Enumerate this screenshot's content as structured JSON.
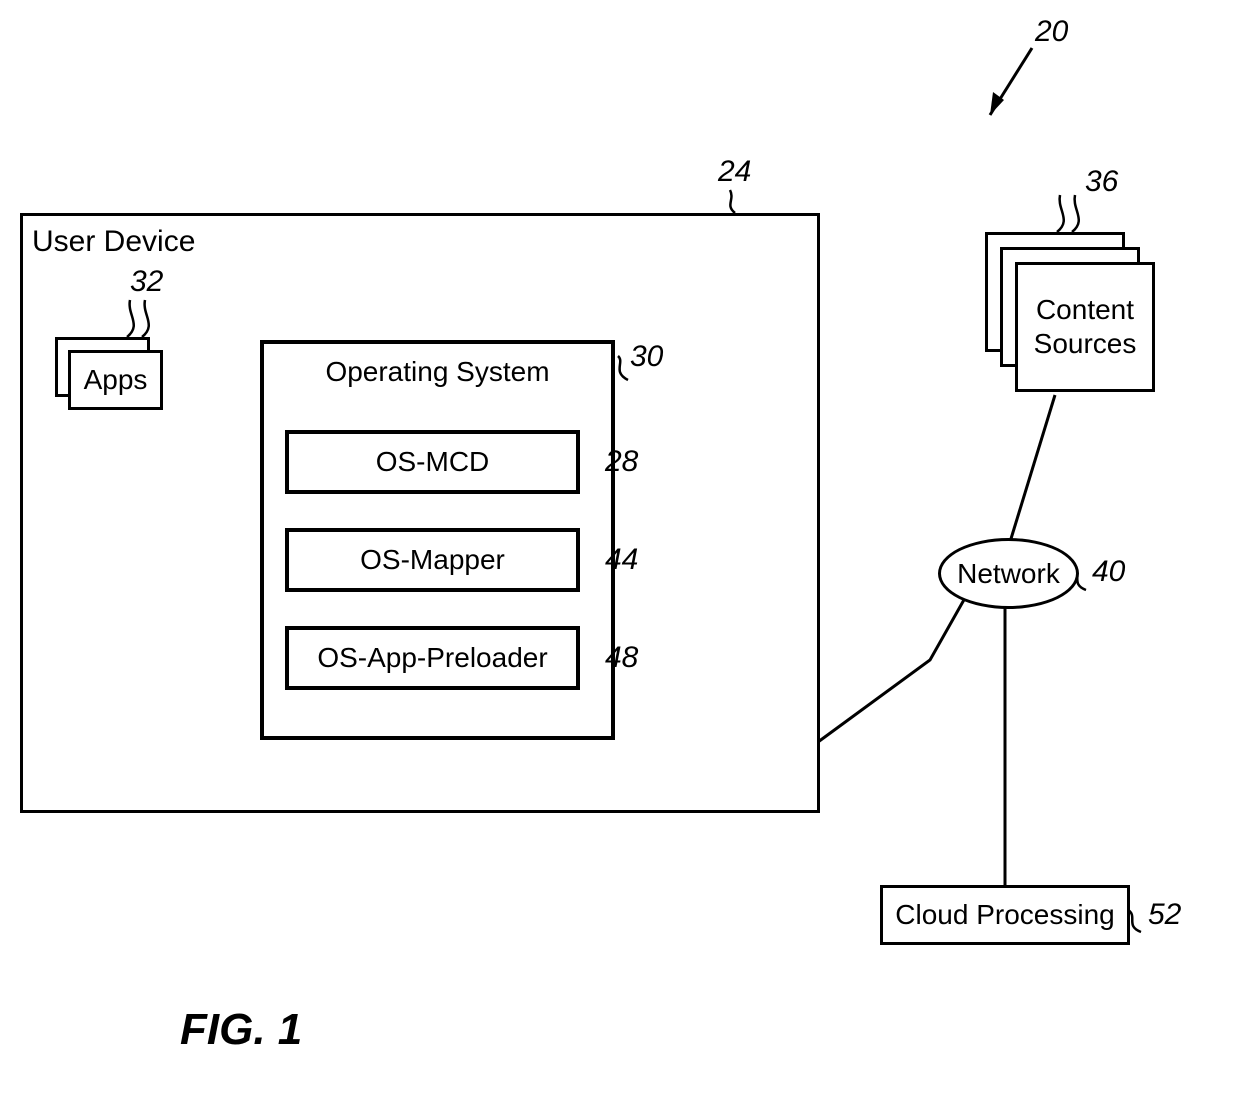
{
  "figure_label": "FIG. 1",
  "refs": {
    "system": "20",
    "user_device": "24",
    "os_mcd": "28",
    "operating_system": "30",
    "apps": "32",
    "content_sources": "36",
    "network": "40",
    "os_mapper": "44",
    "os_app_preloader": "48",
    "cloud_processing": "52"
  },
  "labels": {
    "user_device": "User Device",
    "apps": "Apps",
    "operating_system": "Operating System",
    "os_mcd": "OS-MCD",
    "os_mapper": "OS-Mapper",
    "os_app_preloader": "OS-App-Preloader",
    "content_sources": "Content\nSources",
    "network": "Network",
    "cloud_processing": "Cloud Processing"
  }
}
